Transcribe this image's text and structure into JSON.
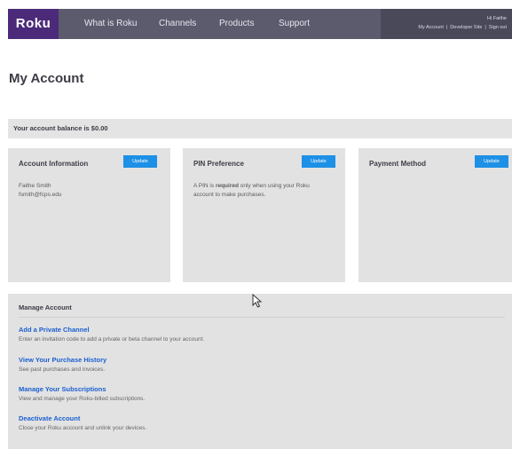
{
  "header": {
    "logo": "Roku",
    "nav": [
      "What is Roku",
      "Channels",
      "Products",
      "Support"
    ],
    "greeting": "Hi Faithe",
    "account_links": [
      "My Account",
      "Developer Site",
      "Sign out"
    ],
    "link_separator": "|"
  },
  "page": {
    "title": "My Account"
  },
  "balance": {
    "text": "Your account balance is $0.00"
  },
  "cards": [
    {
      "title": "Account Information",
      "button": "Update",
      "lines": [
        "Faithe Smith",
        "fsmith@fcps.edu"
      ]
    },
    {
      "title": "PIN Preference",
      "button": "Update",
      "text_before": "A PIN is ",
      "text_bold": "required",
      "text_after": " only when using your Roku account to make purchases."
    },
    {
      "title": "Payment Method",
      "button": "Update"
    }
  ],
  "manage": {
    "title": "Manage Account",
    "items": [
      {
        "label": "Add a Private Channel",
        "desc": "Enter an invitation code to add a private or beta channel to your account."
      },
      {
        "label": "View Your Purchase History",
        "desc": "See past purchases and invoices."
      },
      {
        "label": "Manage Your Subscriptions",
        "desc": "View and manage your Roku-billed subscriptions."
      },
      {
        "label": "Deactivate Account",
        "desc": "Close your Roku account and unlink your devices."
      }
    ]
  },
  "colors": {
    "nav_bg": "#5c5b6e",
    "logo_bg": "#4b2a7a",
    "button": "#1e90e6",
    "link": "#1b5fd1",
    "panel": "#e2e2e2"
  },
  "cursor": {
    "icon": "mouse-pointer-icon"
  }
}
